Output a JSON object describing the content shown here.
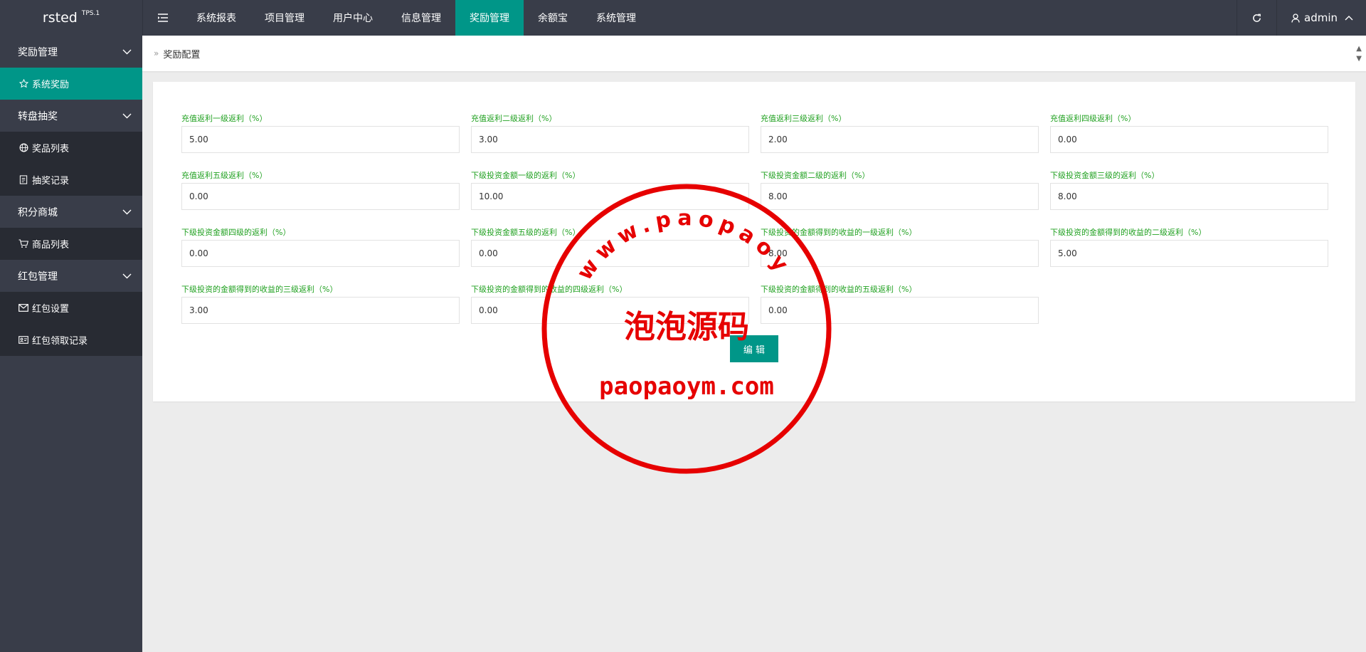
{
  "brand": {
    "name": "rsted",
    "version": "TPS.1"
  },
  "header": {
    "nav": [
      "系统报表",
      "项目管理",
      "用户中心",
      "信息管理",
      "奖励管理",
      "余额宝",
      "系统管理"
    ],
    "user": "admin"
  },
  "sidebar": {
    "groups": [
      {
        "label": "奖励管理",
        "items": [
          {
            "label": "系统奖励",
            "icon": "star-icon"
          }
        ]
      },
      {
        "label": "转盘抽奖",
        "items": [
          {
            "label": "奖品列表",
            "icon": "globe-icon"
          },
          {
            "label": "抽奖记录",
            "icon": "document-icon"
          }
        ]
      },
      {
        "label": "积分商城",
        "items": [
          {
            "label": "商品列表",
            "icon": "cart-icon"
          }
        ]
      },
      {
        "label": "红包管理",
        "items": [
          {
            "label": "红包设置",
            "icon": "envelope-icon"
          },
          {
            "label": "红包领取记录",
            "icon": "card-icon"
          }
        ]
      }
    ]
  },
  "breadcrumb": "奖励配置",
  "form": {
    "fields": [
      {
        "label": "充值返利一级返利（%）",
        "value": "5.00"
      },
      {
        "label": "充值返利二级返利（%）",
        "value": "3.00"
      },
      {
        "label": "充值返利三级返利（%）",
        "value": "2.00"
      },
      {
        "label": "充值返利四级返利（%）",
        "value": "0.00"
      },
      {
        "label": "充值返利五级返利（%）",
        "value": "0.00"
      },
      {
        "label": "下级投资金额一级的返利（%）",
        "value": "10.00"
      },
      {
        "label": "下级投资金额二级的返利（%）",
        "value": "8.00"
      },
      {
        "label": "下级投资金额三级的返利（%）",
        "value": "8.00"
      },
      {
        "label": "下级投资金额四级的返利（%）",
        "value": "0.00"
      },
      {
        "label": "下级投资金额五级的返利（%）",
        "value": "0.00"
      },
      {
        "label": "下级投资的金额得到的收益的一级返利（%）",
        "value": "8.00"
      },
      {
        "label": "下级投资的金额得到的收益的二级返利（%）",
        "value": "5.00"
      },
      {
        "label": "下级投资的金额得到的收益的三级返利（%）",
        "value": "3.00"
      },
      {
        "label": "下级投资的金额得到的收益的四级返利（%）",
        "value": "0.00"
      },
      {
        "label": "下级投资的金额得到的收益的五级返利（%）",
        "value": "0.00"
      }
    ],
    "edit_label": "编 辑"
  },
  "watermark": {
    "arc": "www.paopaoym.com",
    "title": "泡泡源码",
    "bottom": "paopaoym.com"
  },
  "colors": {
    "accent": "#009688",
    "topbar": "#393d49",
    "sidebar_sub": "#282b33",
    "label_green": "#21a121",
    "stamp_red": "#e60000"
  }
}
